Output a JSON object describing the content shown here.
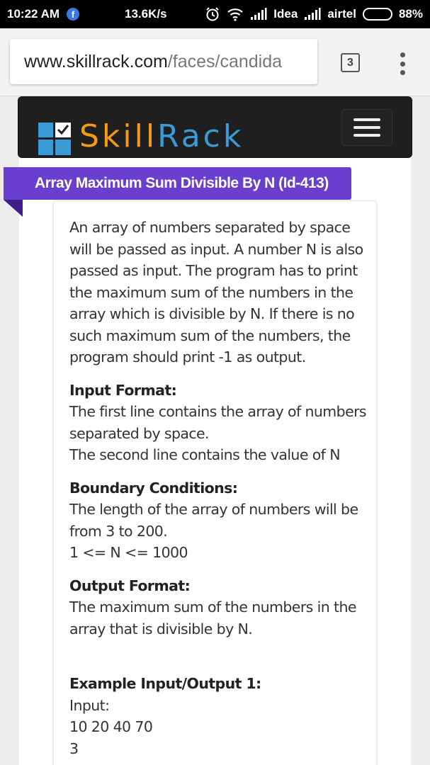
{
  "status_bar": {
    "time": "10:22 AM",
    "speed": "13.6K/s",
    "carrier1": "Idea",
    "carrier2": "airtel",
    "battery": "88%",
    "battery_level": 0.88
  },
  "browser": {
    "url_domain": "www.skillrack.com",
    "url_path": "/faces/candida",
    "tab_count": "3"
  },
  "header": {
    "logo_skill": "Skill",
    "logo_rack": "Rack"
  },
  "problem": {
    "title": "Array Maximum Sum Divisible By N (Id-413)",
    "description": "An array of numbers separated by space will be passed as input. A number N is also passed as input. The program has to print the maximum sum of the numbers in the array which is divisible by N. If there is no such maximum sum of the numbers, the program should print -1 as output.",
    "input_format_heading": "Input Format:",
    "input_format_line1": "The first line contains the array of numbers separated by space.",
    "input_format_line2": "The second line contains the value of N",
    "boundary_heading": "Boundary Conditions:",
    "boundary_line1": "The length of the array of numbers will be from 3 to 200.",
    "boundary_line2": "1 <= N <= 1000",
    "output_format_heading": "Output Format:",
    "output_format_line1": "The maximum sum of the numbers in the array that is divisible by N.",
    "example_heading": "Example Input/Output 1:",
    "example_input_label": "Input:",
    "example_input_line1": "10 20 40 70",
    "example_input_line2": "3"
  },
  "colors": {
    "ribbon": "#6a3fcf",
    "logo_orange": "#f39c12",
    "logo_blue": "#3a9bd9"
  }
}
